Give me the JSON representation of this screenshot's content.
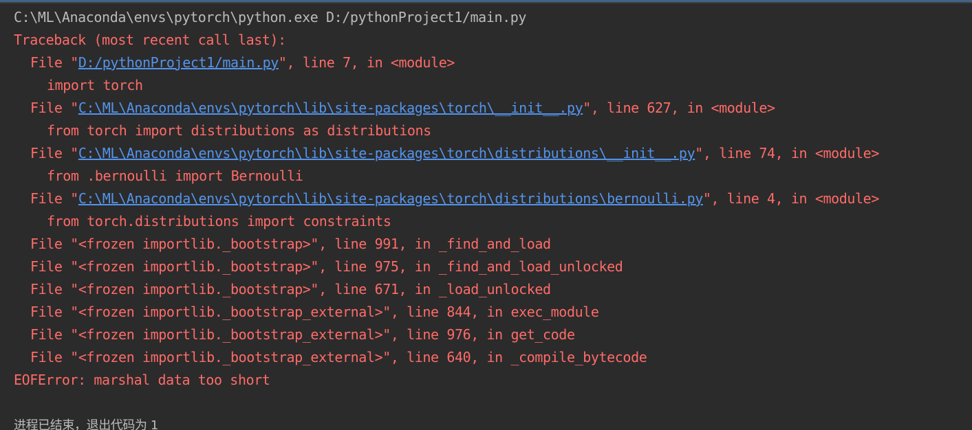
{
  "command": "C:\\ML\\Anaconda\\envs\\pytorch\\python.exe D:/pythonProject1/main.py",
  "traceback_header": "Traceback (most recent call last):",
  "frames": [
    {
      "prefix": "File \"",
      "path": "D:/pythonProject1/main.py",
      "suffix": "\", line 7, in <module>",
      "code": "import torch"
    },
    {
      "prefix": "File \"",
      "path": "C:\\ML\\Anaconda\\envs\\pytorch\\lib\\site-packages\\torch\\__init__.py",
      "suffix": "\", line 627, in <module>",
      "code": "from torch import distributions as distributions"
    },
    {
      "prefix": "File \"",
      "path": "C:\\ML\\Anaconda\\envs\\pytorch\\lib\\site-packages\\torch\\distributions\\__init__.py",
      "suffix": "\", line 74, in <module>",
      "code": "from .bernoulli import Bernoulli"
    },
    {
      "prefix": "File \"",
      "path": "C:\\ML\\Anaconda\\envs\\pytorch\\lib\\site-packages\\torch\\distributions\\bernoulli.py",
      "suffix": "\", line 4, in <module>",
      "code": "from torch.distributions import constraints"
    }
  ],
  "frozen_frames": [
    "File \"<frozen importlib._bootstrap>\", line 991, in _find_and_load",
    "File \"<frozen importlib._bootstrap>\", line 975, in _find_and_load_unlocked",
    "File \"<frozen importlib._bootstrap>\", line 671, in _load_unlocked",
    "File \"<frozen importlib._bootstrap_external>\", line 844, in exec_module",
    "File \"<frozen importlib._bootstrap_external>\", line 976, in get_code",
    "File \"<frozen importlib._bootstrap_external>\", line 640, in _compile_bytecode"
  ],
  "error": "EOFError: marshal data too short",
  "exit_message": "进程已结束，退出代码为 1",
  "colors": {
    "background": "#2b2b2b",
    "command_text": "#bbbbbb",
    "error_text": "#ff6b68",
    "link": "#5394ec"
  }
}
